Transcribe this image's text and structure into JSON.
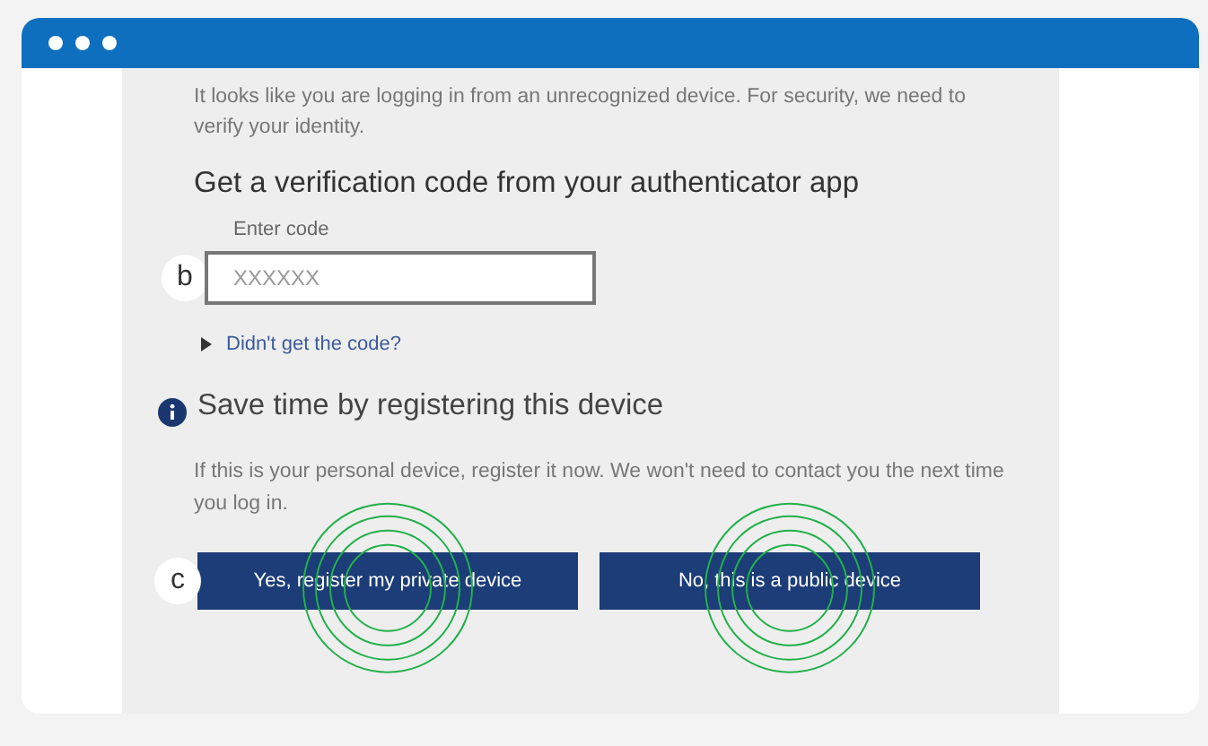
{
  "intro": "It looks like you are logging in from an unrecognized device. For security, we need to verify your identity.",
  "heading": "Get a verification code from your authenticator app",
  "code_field": {
    "label": "Enter code",
    "placeholder": "XXXXXX",
    "badge": "b"
  },
  "help_link": {
    "text": "Didn't get the code?",
    "expanded": false
  },
  "register": {
    "heading": "Save time by registering this device",
    "body": "If this is your personal device, register it now. We won't need to contact you the next time you log in.",
    "badge": "c"
  },
  "buttons": [
    {
      "label": "Yes, register my private device",
      "tapped": true
    },
    {
      "label": "No, this is a public device",
      "tapped": true
    }
  ]
}
